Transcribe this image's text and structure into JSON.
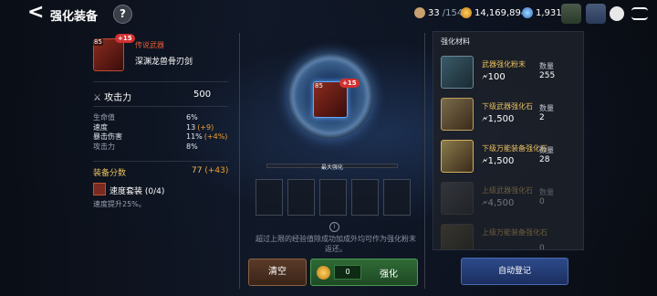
{
  "header": {
    "back_glyph": "<",
    "title": "强化装备",
    "help_glyph": "?"
  },
  "resources": {
    "stamina_current": "33",
    "stamina_max": "/154",
    "gold": "14,169,894",
    "crystal": "1,931"
  },
  "item": {
    "level": "85",
    "plus": "+15",
    "grade": "传说武器",
    "name": "深渊龙兽骨刃剑",
    "attack_label": "攻击力",
    "attack_value": "500",
    "stats": [
      {
        "name": "生命值",
        "value": "6%",
        "bonus": ""
      },
      {
        "name": "速度",
        "value": "13",
        "bonus": "(+9)"
      },
      {
        "name": "暴击伤害",
        "value": "11%",
        "bonus": "(+4%)"
      },
      {
        "name": "攻击力",
        "value": "8%",
        "bonus": ""
      }
    ],
    "score_label": "装备分数",
    "score_value": "77",
    "score_bonus": "(+43)",
    "set_name": "速度套装 (0/4)",
    "set_desc": "速度提升25%。"
  },
  "enhance": {
    "max_label": "最大强化",
    "info_glyph": "i",
    "note": "超过上限的经验值除成功加成外均可作为强化粉末返还。",
    "clear_label": "清空",
    "cost_value": "0",
    "enhance_label": "强化"
  },
  "materials": {
    "title": "强化材料",
    "qty_label": "数量",
    "items": [
      {
        "name": "武器强化粉末",
        "exp": "100",
        "qty": "255"
      },
      {
        "name": "下级武器强化石",
        "exp": "1,500",
        "qty": "2"
      },
      {
        "name": "下级万能装备强化石",
        "exp": "1,500",
        "qty": "28"
      },
      {
        "name": "上级武器强化石",
        "exp": "4,500",
        "qty": "0"
      },
      {
        "name": "上级万能装备强化石",
        "exp": "",
        "qty": "0"
      }
    ],
    "auto_label": "自动登记"
  },
  "colors": {
    "accent_gold": "#e8c060",
    "bonus_orange": "#f0a030",
    "legendary_red": "#e05a3a",
    "enhance_green": "#2f6a36",
    "auto_blue": "#2c4a8a"
  }
}
